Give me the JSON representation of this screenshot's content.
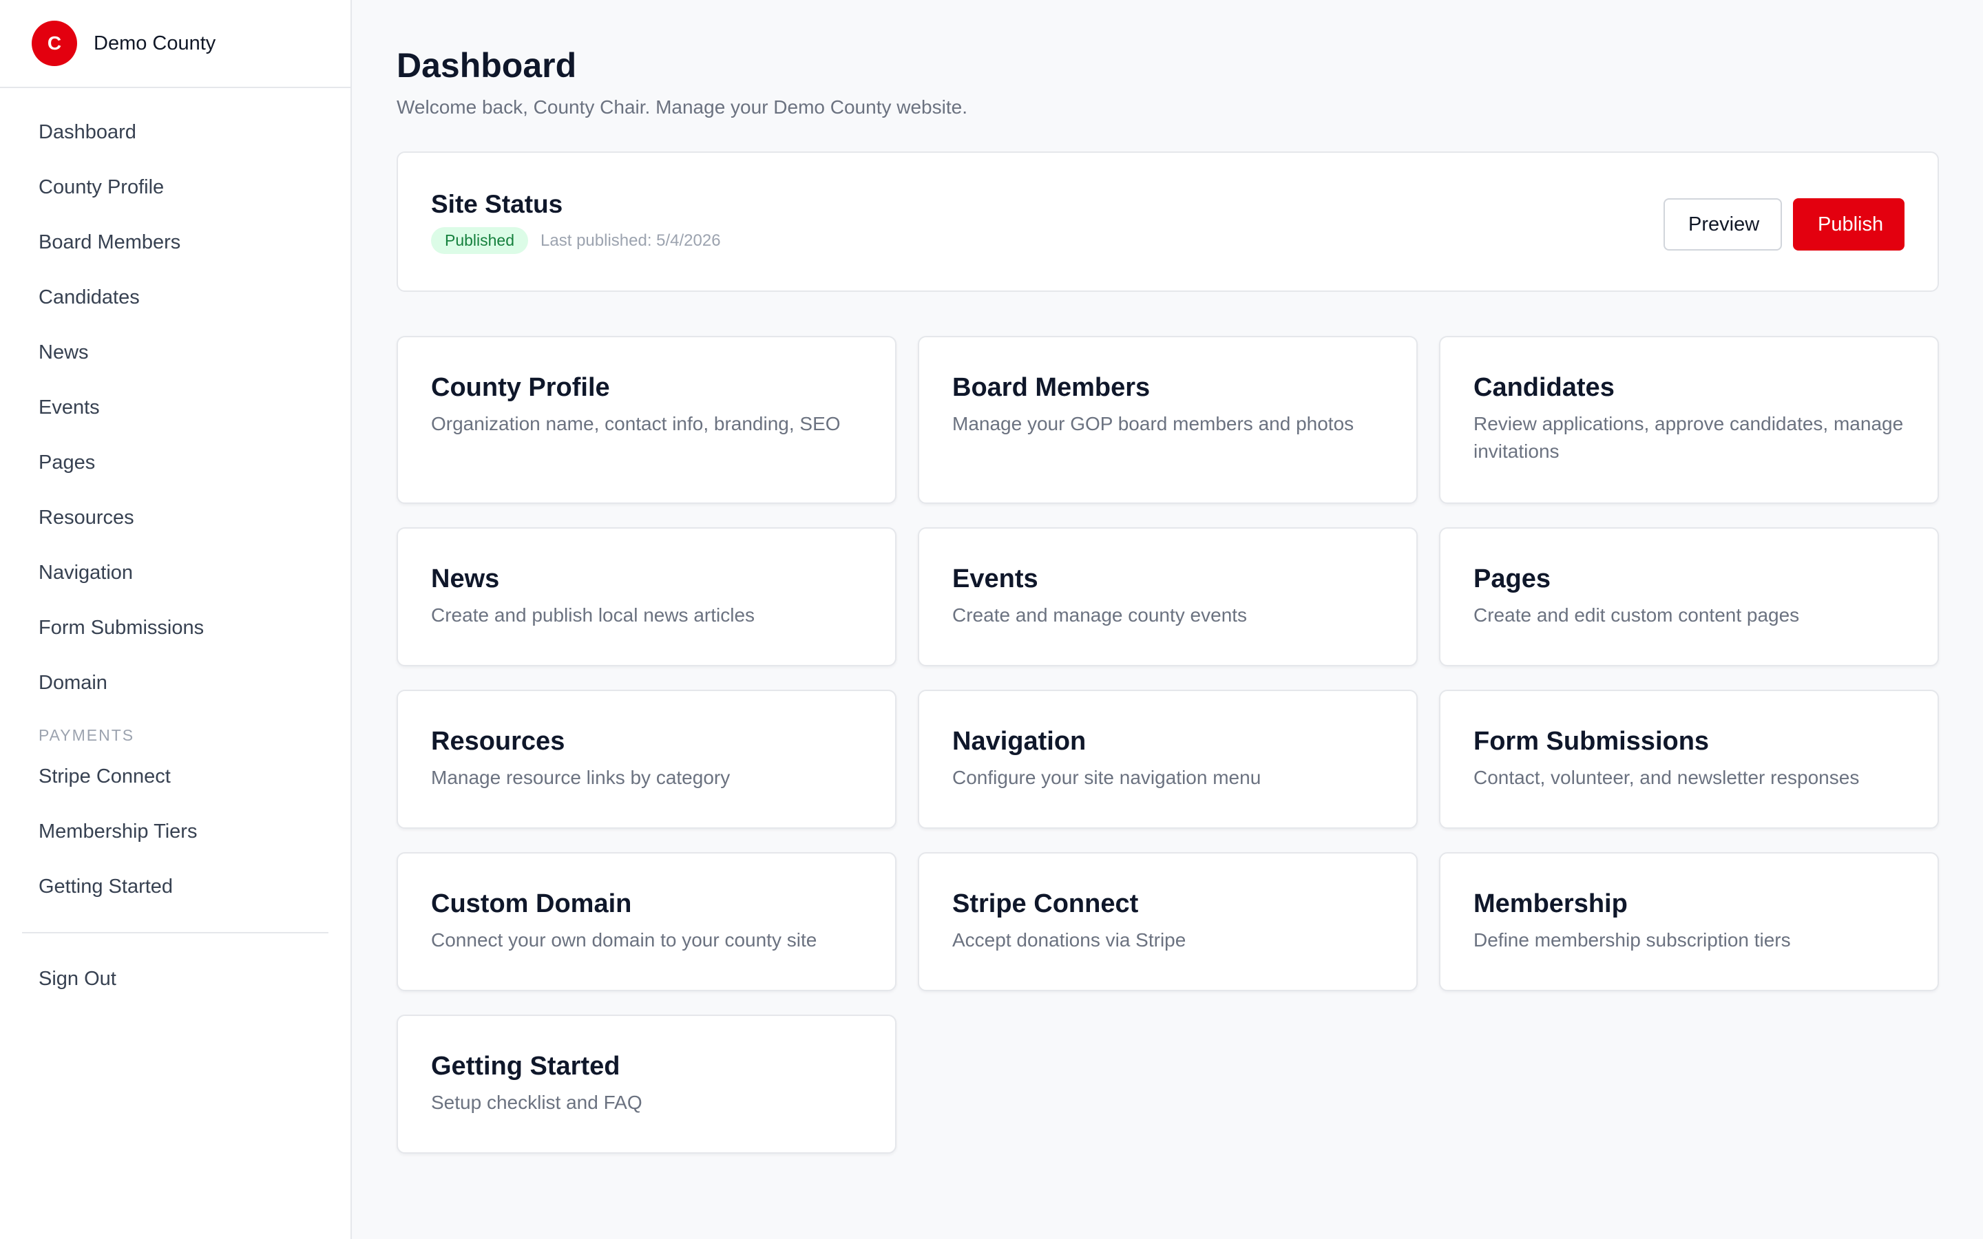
{
  "brand": {
    "logo_letter": "C",
    "name": "Demo County",
    "logo_color": "#e3000f"
  },
  "sidebar": {
    "items": [
      {
        "label": "Dashboard"
      },
      {
        "label": "County Profile"
      },
      {
        "label": "Board Members"
      },
      {
        "label": "Candidates"
      },
      {
        "label": "News"
      },
      {
        "label": "Events"
      },
      {
        "label": "Pages"
      },
      {
        "label": "Resources"
      },
      {
        "label": "Navigation"
      },
      {
        "label": "Form Submissions"
      },
      {
        "label": "Domain"
      }
    ],
    "payments_heading": "PAYMENTS",
    "payment_items": [
      {
        "label": "Stripe Connect"
      },
      {
        "label": "Membership Tiers"
      },
      {
        "label": "Getting Started"
      }
    ],
    "sign_out": "Sign Out"
  },
  "header": {
    "title": "Dashboard",
    "subtitle": "Welcome back, County Chair. Manage your Demo County website."
  },
  "site_status": {
    "title": "Site Status",
    "badge": "Published",
    "last_published": "Last published: 5/4/2026",
    "preview_label": "Preview",
    "publish_label": "Publish"
  },
  "cards": [
    {
      "title": "County Profile",
      "desc": "Organization name, contact info, branding, SEO"
    },
    {
      "title": "Board Members",
      "desc": "Manage your GOP board members and photos"
    },
    {
      "title": "Candidates",
      "desc": "Review applications, approve candidates, manage invitations"
    },
    {
      "title": "News",
      "desc": "Create and publish local news articles"
    },
    {
      "title": "Events",
      "desc": "Create and manage county events"
    },
    {
      "title": "Pages",
      "desc": "Create and edit custom content pages"
    },
    {
      "title": "Resources",
      "desc": "Manage resource links by category"
    },
    {
      "title": "Navigation",
      "desc": "Configure your site navigation menu"
    },
    {
      "title": "Form Submissions",
      "desc": "Contact, volunteer, and newsletter responses"
    },
    {
      "title": "Custom Domain",
      "desc": "Connect your own domain to your county site"
    },
    {
      "title": "Stripe Connect",
      "desc": "Accept donations via Stripe"
    },
    {
      "title": "Membership",
      "desc": "Define membership subscription tiers"
    },
    {
      "title": "Getting Started",
      "desc": "Setup checklist and FAQ"
    }
  ],
  "colors": {
    "accent": "#e3000f",
    "badge_bg": "#dcfce7",
    "badge_text": "#15803d"
  }
}
